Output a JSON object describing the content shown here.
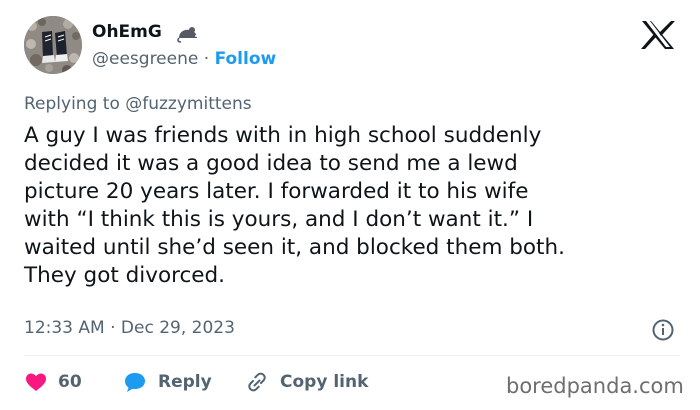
{
  "author": {
    "name": "OhEmG",
    "handle": "@eesgreene",
    "separator": " · ",
    "follow_label": "Follow"
  },
  "icons": {
    "name_badge": "mouse-icon",
    "close": "x-logo-icon",
    "info": "info-icon",
    "like": "heart-icon",
    "reply": "speech-bubble-icon",
    "copy_link": "link-icon"
  },
  "reply": {
    "prefix": "Replying to ",
    "target": "@fuzzymittens"
  },
  "tweet": {
    "text": "A guy I was friends with in high school suddenly\ndecided it was a good idea to send me a lewd\npicture 20 years later. I forwarded it to his wife\nwith “I think this is yours, and I don’t want it.” I\nwaited until she’d seen it, and blocked them both.\nThey got divorced.",
    "timestamp": "12:33 AM · Dec 29, 2023"
  },
  "actions": {
    "likes": "60",
    "reply_label": "Reply",
    "copy_link_label": "Copy link"
  },
  "watermark": "boredpanda.com",
  "colors": {
    "accent": "#1d9bf0",
    "like": "#f91880",
    "muted": "#536471",
    "text": "#0f1419"
  }
}
